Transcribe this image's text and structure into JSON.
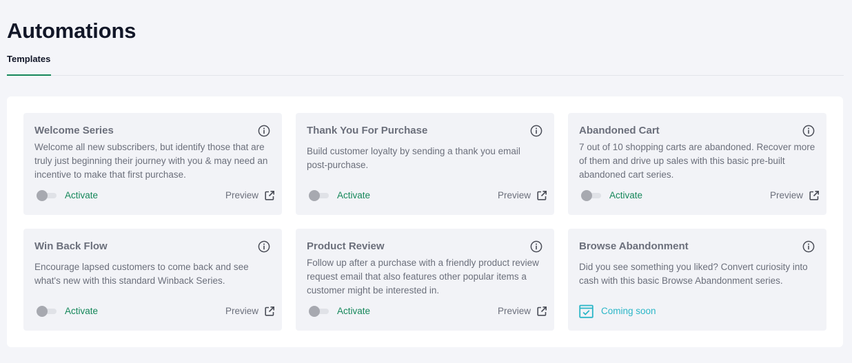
{
  "page": {
    "title": "Automations"
  },
  "tabs": [
    {
      "label": "Templates",
      "active": true
    }
  ],
  "colors": {
    "accent_green": "#15875a",
    "coming_soon_teal": "#2ab6c7",
    "card_bg": "#f2f3f7",
    "muted_text": "#6b6f7b"
  },
  "cards": [
    {
      "title": "Welcome Series",
      "description": "Welcome all new subscribers, but identify those that are truly just beginning their journey with you & may need an incentive to make that first purchase.",
      "status": "toggle",
      "activate_label": "Activate",
      "active": false,
      "preview_label": "Preview",
      "icons": {
        "info": "info-icon",
        "preview": "external-link-icon"
      }
    },
    {
      "title": "Thank You For Purchase",
      "description": "Build customer loyalty by sending a thank you email post-purchase.",
      "status": "toggle",
      "activate_label": "Activate",
      "active": false,
      "preview_label": "Preview",
      "icons": {
        "info": "info-icon",
        "preview": "external-link-icon"
      }
    },
    {
      "title": "Abandoned Cart",
      "description": "7 out of 10 shopping carts are abandoned. Recover more of them and drive up sales with this basic pre-built abandoned cart series.",
      "status": "toggle",
      "activate_label": "Activate",
      "active": false,
      "preview_label": "Preview",
      "icons": {
        "info": "info-icon",
        "preview": "external-link-icon"
      }
    },
    {
      "title": "Win Back Flow",
      "description": "Encourage lapsed customers to come back and see what's new with this standard Winback Series.",
      "status": "toggle",
      "activate_label": "Activate",
      "active": false,
      "preview_label": "Preview",
      "icons": {
        "info": "info-icon",
        "preview": "external-link-icon"
      }
    },
    {
      "title": "Product Review",
      "description": "Follow up after a purchase with a friendly product review request email that also features other popular items a customer might be interested in.",
      "status": "toggle",
      "activate_label": "Activate",
      "active": false,
      "preview_label": "Preview",
      "icons": {
        "info": "info-icon",
        "preview": "external-link-icon"
      }
    },
    {
      "title": "Browse Abandonment",
      "description": "Did you see something you liked? Convert curiosity into cash with this basic Browse Abandonment series.",
      "status": "coming_soon",
      "coming_soon_label": "Coming soon",
      "icons": {
        "info": "info-icon",
        "status": "calendar-check-icon"
      }
    }
  ]
}
